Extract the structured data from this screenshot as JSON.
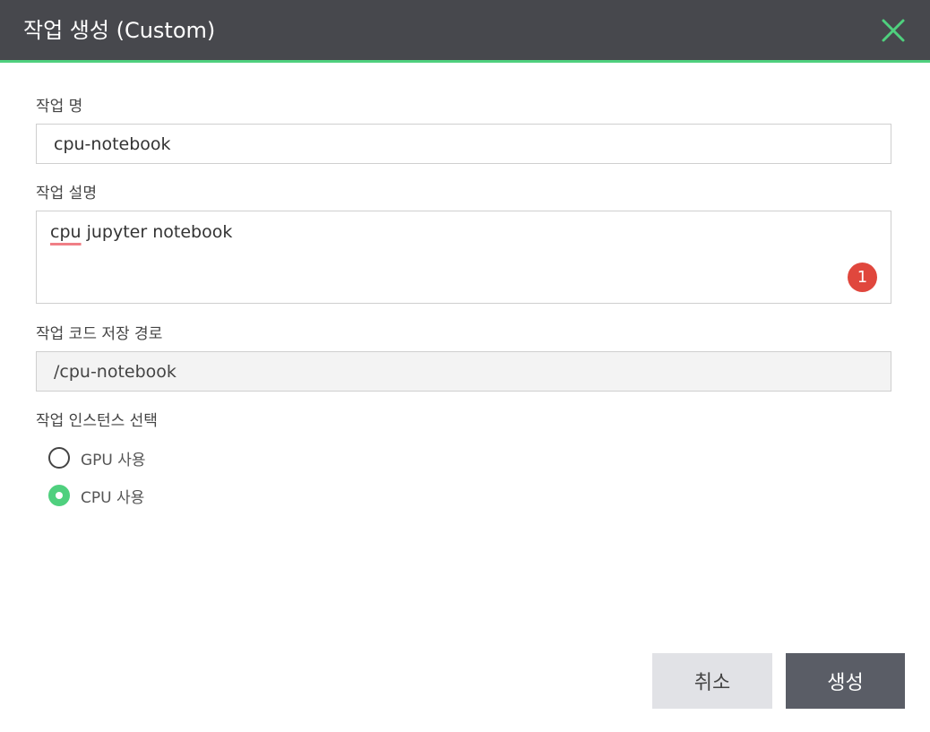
{
  "dialog": {
    "title": "작업 생성 (Custom)",
    "close_icon": "close-icon",
    "accent_color": "#4fd07e"
  },
  "form": {
    "job_name": {
      "label": "작업 명",
      "value": "cpu-notebook"
    },
    "job_description": {
      "label": "작업 설명",
      "value_misspelled": "cpu",
      "value_rest": " jupyter notebook",
      "badge_count": "1"
    },
    "code_path": {
      "label": "작업 코드 저장 경로",
      "value": "/cpu-notebook"
    },
    "instance": {
      "label": "작업 인스턴스 선택",
      "options": [
        {
          "label": "GPU 사용",
          "selected": false
        },
        {
          "label": "CPU 사용",
          "selected": true
        }
      ]
    }
  },
  "actions": {
    "cancel_label": "취소",
    "create_label": "생성"
  }
}
